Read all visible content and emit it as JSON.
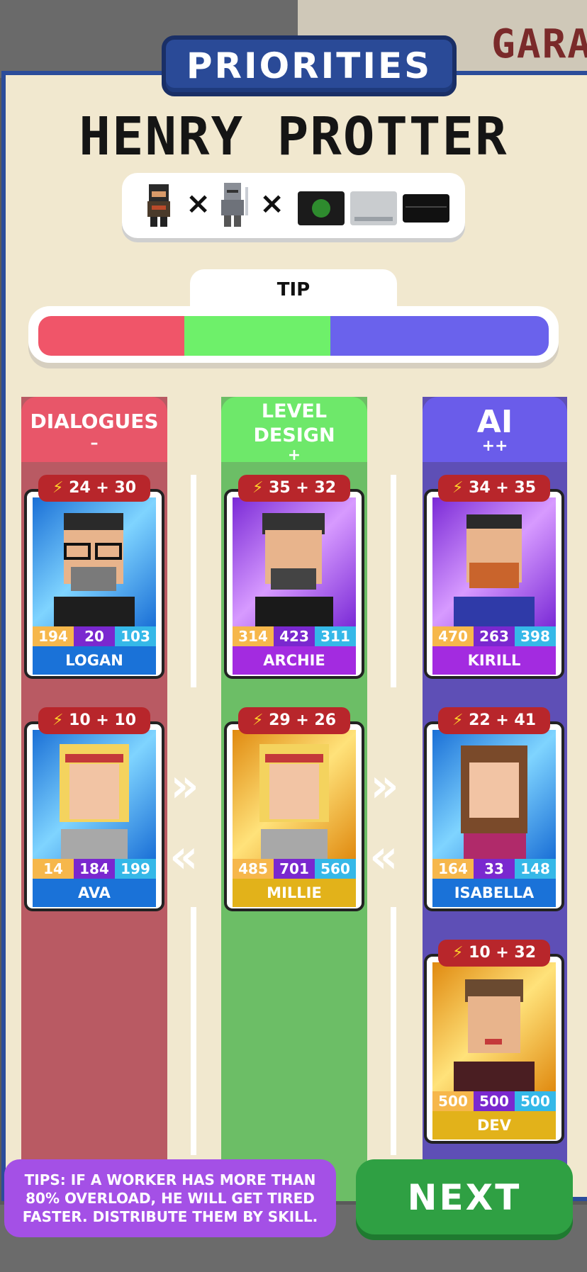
{
  "header": {
    "title": "PRIORITIES",
    "game_name": "HENRY PROTTER",
    "background_sign": "GARA"
  },
  "platforms": {
    "items": [
      "ninja-sprite",
      "knight-sprite",
      "console-black-box",
      "console-grey-box",
      "console-black-slim"
    ],
    "separators": [
      "×",
      "×"
    ]
  },
  "tip": {
    "label": "TIP",
    "segments": [
      {
        "color": "#f05569",
        "fraction": 0.333
      },
      {
        "color": "#6ef06a",
        "fraction": 0.333
      },
      {
        "color": "#6a62ec",
        "fraction": 0.334
      }
    ]
  },
  "columns": [
    {
      "title": "DIALOGUES",
      "priority": "–",
      "color": "#e85669",
      "bg": "#b95a63",
      "workers": [
        {
          "name": "LOGAN",
          "energy": "24 + 30",
          "stats": [
            "194",
            "20",
            "103"
          ],
          "card_theme": "blue"
        },
        {
          "name": "AVA",
          "energy": "10 + 10",
          "stats": [
            "14",
            "184",
            "199"
          ],
          "card_theme": "blue"
        }
      ]
    },
    {
      "title": "LEVEL DESIGN",
      "priority": "+",
      "color": "#6ee86a",
      "bg": "#6cbe66",
      "workers": [
        {
          "name": "ARCHIE",
          "energy": "35 + 32",
          "stats": [
            "314",
            "423",
            "311"
          ],
          "card_theme": "purple"
        },
        {
          "name": "MILLIE",
          "energy": "29 + 26",
          "stats": [
            "485",
            "701",
            "560"
          ],
          "card_theme": "gold"
        }
      ]
    },
    {
      "title": "AI",
      "priority": "++",
      "color": "#6a5cea",
      "bg": "#5e4fb6",
      "workers": [
        {
          "name": "KIRILL",
          "energy": "34 + 35",
          "stats": [
            "470",
            "263",
            "398"
          ],
          "card_theme": "purple"
        },
        {
          "name": "ISABELLA",
          "energy": "22 + 41",
          "stats": [
            "164",
            "33",
            "148"
          ],
          "card_theme": "blue"
        },
        {
          "name": "DEV",
          "energy": "10 + 32",
          "stats": [
            "500",
            "500",
            "500"
          ],
          "card_theme": "gold"
        }
      ]
    }
  ],
  "footer": {
    "tips_text": "TIPS: IF A WORKER HAS MORE THAN 80% OVERLOAD, HE WILL GET TIRED FASTER. DISTRIBUTE THEM BY SKILL.",
    "next_label": "NEXT"
  }
}
